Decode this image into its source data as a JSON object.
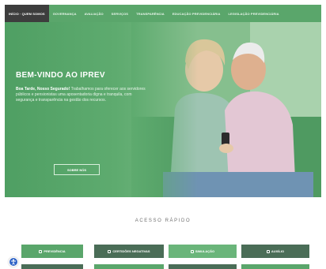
{
  "nav": {
    "items": [
      "Início · Quem Somos",
      "Governança",
      "Avaliação",
      "Serviços",
      "Transparência",
      "Educação Previdenciária",
      "Legislação Previdenciária"
    ],
    "active_index": 0
  },
  "hero": {
    "title": "Bem-vindo ao IPREV",
    "greeting": "Boa Tarde, Nosso Segurado!",
    "body": "Trabalhamos para oferecer aos servidores públicos e pensionistas uma aposentadoria digna e tranquila, com segurança e transparência na gestão dos recursos.",
    "cta_label": "Sobre nós"
  },
  "quick_access": {
    "heading": "Acesso Rápido",
    "row1": [
      "Previdência",
      "Certidões Negativas",
      "Simulação",
      "Auxílio"
    ],
    "row1_colors": [
      "#5aa66b",
      "#4a6d57",
      "#6ab57a",
      "#4a6d57"
    ]
  },
  "colors": {
    "brand_green": "#5aa66b",
    "dark_green": "#4a6d57",
    "accessibility": "#2f63c6"
  }
}
